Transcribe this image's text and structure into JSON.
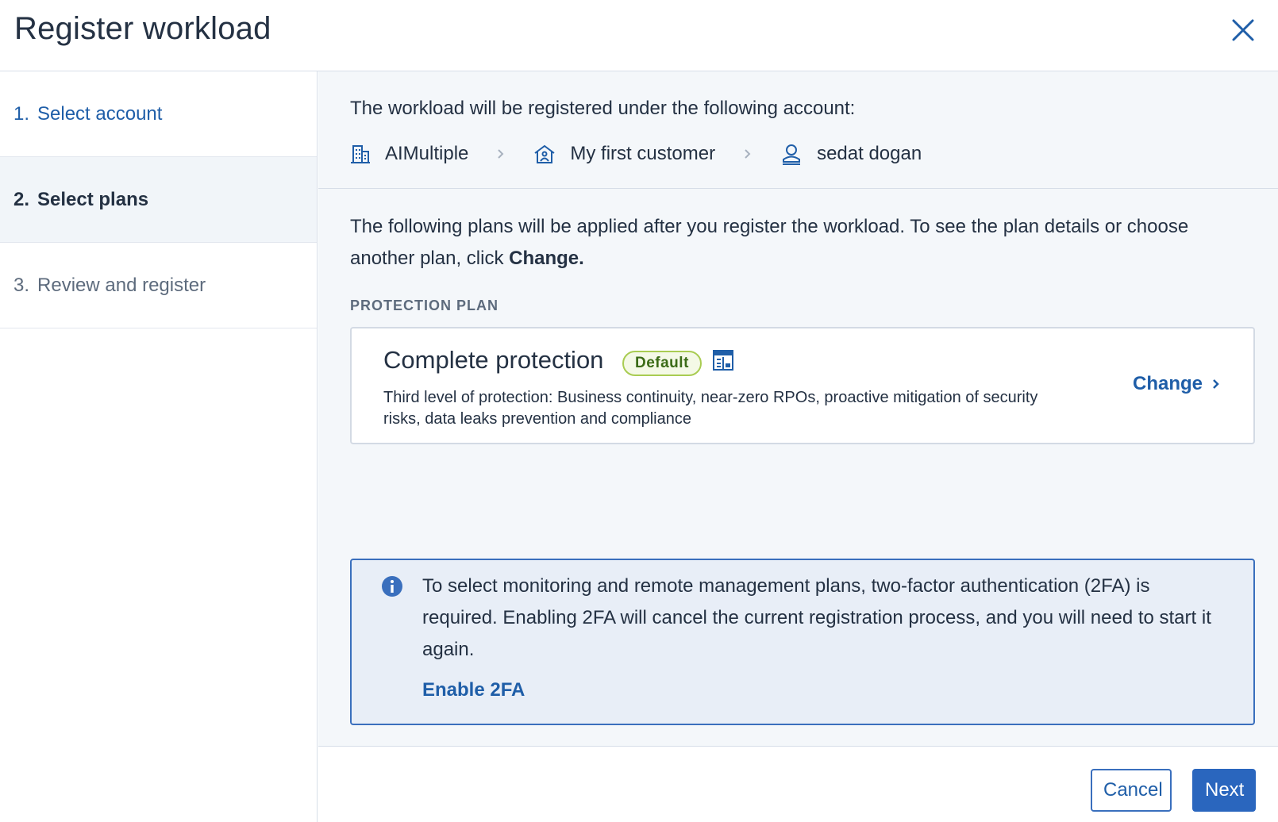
{
  "dialog": {
    "title": "Register workload"
  },
  "steps": [
    {
      "number": "1.",
      "label": "Select account",
      "state": "completed"
    },
    {
      "number": "2.",
      "label": "Select plans",
      "state": "active"
    },
    {
      "number": "3.",
      "label": "Review and register",
      "state": "pending"
    }
  ],
  "account": {
    "intro": "The workload will be registered under the following account:",
    "path": [
      {
        "label": "AIMultiple",
        "icon": "building-icon"
      },
      {
        "label": "My first customer",
        "icon": "customer-house-icon"
      },
      {
        "label": "sedat dogan",
        "icon": "user-icon"
      }
    ]
  },
  "plans": {
    "intro_text": "The following plans will be applied after you register the workload. To see the plan details or choose another plan, click ",
    "intro_bold": "Change.",
    "section_label": "PROTECTION PLAN",
    "protection_plan": {
      "name": "Complete protection",
      "badge": "Default",
      "description": "Third level of protection: Business continuity, near-zero RPOs, proactive mitigation of security risks, data leaks prevention and compliance",
      "change_label": "Change"
    }
  },
  "info": {
    "text": "To select monitoring and remote management plans, two-factor authentication (2FA) is required. Enabling 2FA will cancel the current registration process, and you will need to start it again.",
    "link_label": "Enable 2FA"
  },
  "footer": {
    "cancel_label": "Cancel",
    "next_label": "Next"
  },
  "colors": {
    "accent": "#1f5ea8",
    "primary_button": "#2a66be",
    "badge_border": "#a9cc52",
    "info_background": "#e8eef7"
  }
}
